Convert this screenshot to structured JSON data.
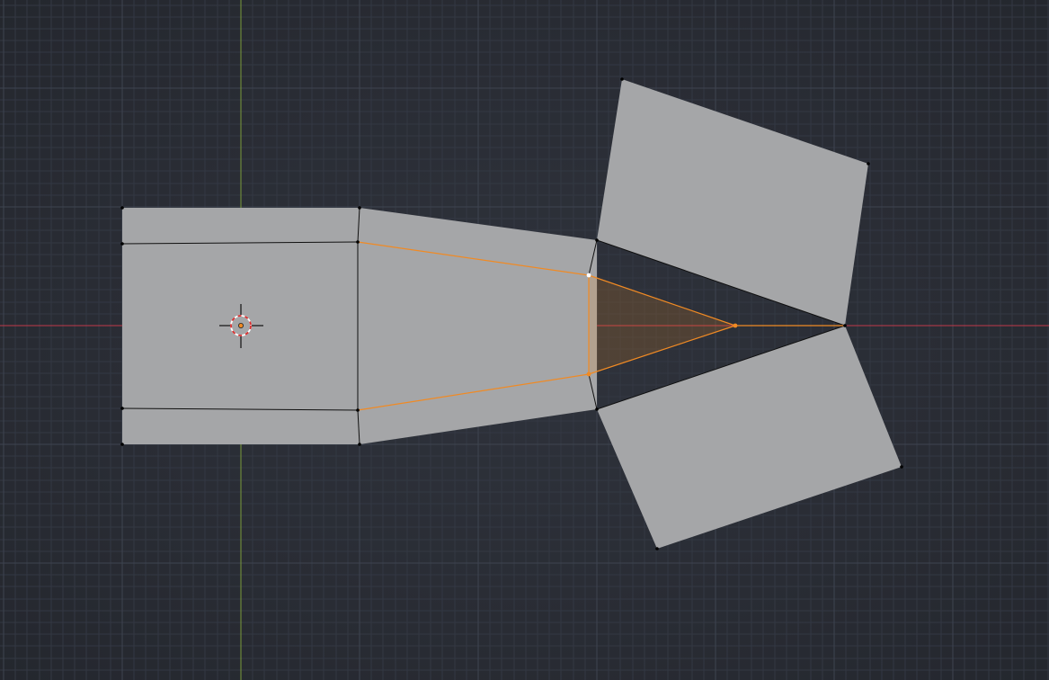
{
  "viewport": {
    "view": "top-orthographic",
    "mode": "edit-mode",
    "selection_mode": "vertex"
  },
  "colors": {
    "background": "#2a2e37",
    "grid_minor": "#333843",
    "grid_major": "#3e4450",
    "axis_x": "#c0394a",
    "axis_y": "#7a9a3a",
    "face": "#a5a6a8",
    "edge": "#101010",
    "vertex": "#000000",
    "selected": "#f08a24",
    "active_vertex": "#ffffff",
    "cursor_ring_a": "#ffffff",
    "cursor_ring_b": "#d83030"
  },
  "icons": {
    "cursor": "3d-cursor-icon",
    "origin": "object-origin-icon"
  }
}
